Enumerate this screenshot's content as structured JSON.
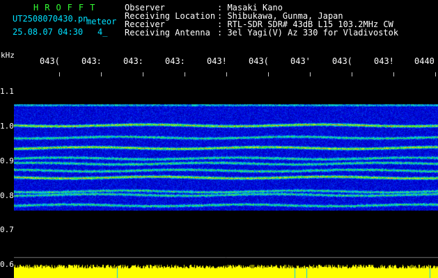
{
  "header": {
    "program_name": "HROFFT",
    "filename": "UT2508070430.pn",
    "mode": "meteor",
    "datetime": "25.08.07 04:30",
    "extra": "4_",
    "fields": [
      {
        "label": "Observer",
        "value": ": Masaki Kano"
      },
      {
        "label": "Receiving Location",
        "value": ": Shibukawa, Gunma, Japan"
      },
      {
        "label": "Receiver",
        "value": ": RTL-SDR SDR# 43dB L15 103.2MHz CW"
      },
      {
        "label": "Receiving Antenna",
        "value": ": 3el Yagi(V) Az 330 for Vladivostok"
      }
    ]
  },
  "axis": {
    "y_unit": "kHz",
    "y_ticks": [
      "1.1",
      "1.0",
      "0.9",
      "0.8",
      "0.7",
      "0.6"
    ],
    "time_labels": [
      "043(",
      "043:",
      "043:",
      "043:",
      "043!",
      "043(",
      "043'",
      "043(",
      "043!",
      "0440"
    ]
  },
  "colors": {
    "background": "#000000",
    "text": "#ffffff",
    "title_text": "#33ff33",
    "noise_floor": "#0a1a8c",
    "signal_line": "#ffdd00",
    "level_bar": "#ffff00"
  }
}
